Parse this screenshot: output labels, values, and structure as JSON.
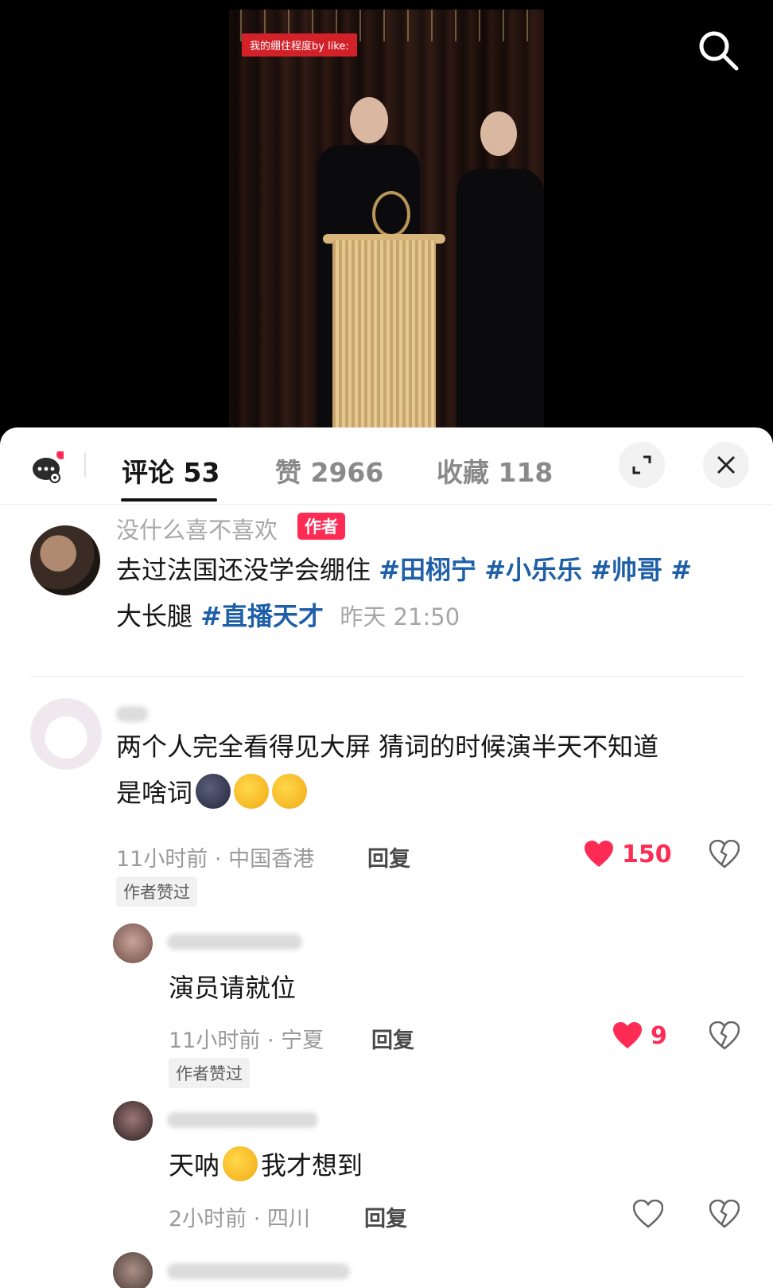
{
  "video": {
    "caption": "我的绷住程度by like:"
  },
  "panel": {
    "tabs": [
      {
        "label": "评论 53"
      },
      {
        "label": "赞 2966"
      },
      {
        "label": "收藏 118"
      }
    ]
  },
  "post": {
    "author_name": "没什么喜不喜欢",
    "author_tag": "作者",
    "text_plain_1": "去过法国还没学会绷住 ",
    "hashtag_1": "#田栩宁",
    "hashtag_2": "#小乐乐",
    "hashtag_3": "#帅哥",
    "hashtag_4": "#",
    "text_plain_2": "大长腿 ",
    "hashtag_5": "#直播天才",
    "time": "昨天 21:50"
  },
  "comments": [
    {
      "text_line_1": "两个人完全看得见大屏 猜词的时候演半天不知道",
      "text_line_2": "是啥词",
      "meta": "11小时前 · 中国香港",
      "reply": "回复",
      "likes": "150",
      "badge": "作者赞过",
      "liked": true
    },
    {
      "text": "演员请就位",
      "meta": "11小时前 · 宁夏",
      "reply": "回复",
      "likes": "9",
      "badge": "作者赞过",
      "liked": true
    },
    {
      "text_before": "天呐",
      "text_after": "我才想到",
      "meta": "2小时前 · 四川",
      "reply": "回复",
      "liked": false
    }
  ],
  "icons": {
    "search": "search-icon",
    "message": "message-bubble-icon",
    "expand": "expand-icon",
    "close": "close-icon",
    "heart": "heart-icon",
    "dislike": "broken-heart-icon"
  },
  "colors": {
    "accent": "#fe2c55",
    "hashtag": "#1f5fa8",
    "caption_bg": "#d3212a"
  }
}
